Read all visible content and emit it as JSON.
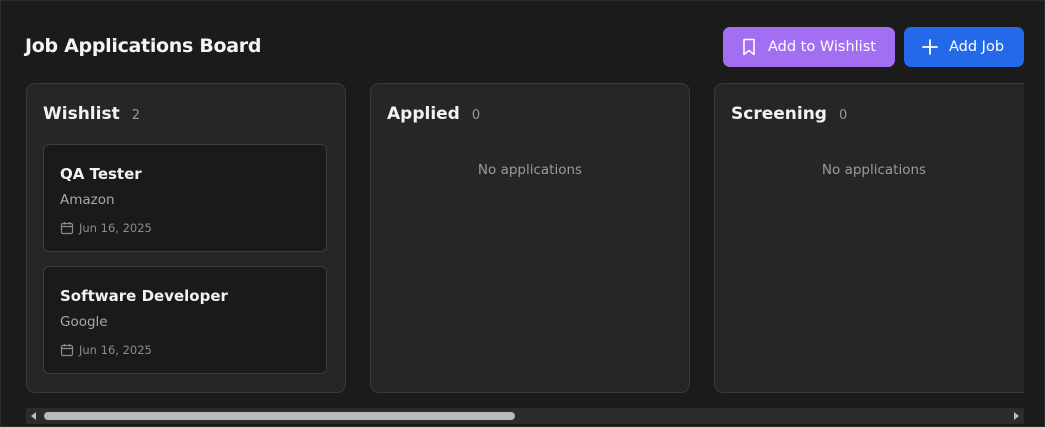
{
  "header": {
    "title": "Job Applications Board",
    "wishlist_button": {
      "label": "Add to Wishlist",
      "icon": "bookmark-icon",
      "color": "#a26ef2"
    },
    "add_job_button": {
      "label": "Add Job",
      "icon": "plus-icon",
      "color": "#2469e9"
    }
  },
  "columns": [
    {
      "title": "Wishlist",
      "count": "2",
      "cards": [
        {
          "title": "QA Tester",
          "company": "Amazon",
          "date": "Jun 16, 2025"
        },
        {
          "title": "Software Developer",
          "company": "Google",
          "date": "Jun 16, 2025"
        }
      ]
    },
    {
      "title": "Applied",
      "count": "0",
      "empty_text": "No applications"
    },
    {
      "title": "Screening",
      "count": "0",
      "empty_text": "No applications"
    }
  ],
  "colors": {
    "background": "#1b1b1b",
    "column_bg": "#262626",
    "card_bg": "#1a1a1a"
  }
}
